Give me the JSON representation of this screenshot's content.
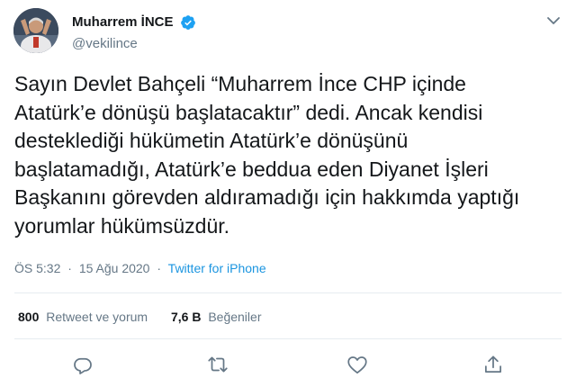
{
  "user": {
    "display_name": "Muharrem İNCE",
    "handle": "@vekilince",
    "verified": true
  },
  "tweet": {
    "text_lines": [
      "Sayın Devlet Bahçeli “Muharrem İnce CHP içinde",
      "Atatürk’e dönüşü başlatacaktır” dedi. Ancak kendisi",
      "desteklediği hükümetin Atatürk’e dönüşünü",
      "başlatamadığı, Atatürk’e beddua eden Diyanet İşleri",
      "Başkanını görevden aldıramadığı için hakkımda yaptığı",
      "yorumlar hükümsüzdür."
    ],
    "time": "ÖS 5:32",
    "separator": "·",
    "date": "15 Ağu 2020",
    "source": "Twitter for iPhone"
  },
  "stats": {
    "retweets_count": "800",
    "retweets_label": "Retweet ve yorum",
    "likes_count": "7,6 B",
    "likes_label": "Beğeniler"
  },
  "icons": {
    "menu": "chevron-down-icon",
    "verified": "verified-badge-icon",
    "reply": "reply-icon",
    "retweet": "retweet-icon",
    "like": "heart-icon",
    "share": "share-icon"
  },
  "colors": {
    "text": "#14171a",
    "muted": "#657786",
    "link": "#1b95e0",
    "verified": "#1da1f2",
    "divider": "#e6ecf0"
  }
}
